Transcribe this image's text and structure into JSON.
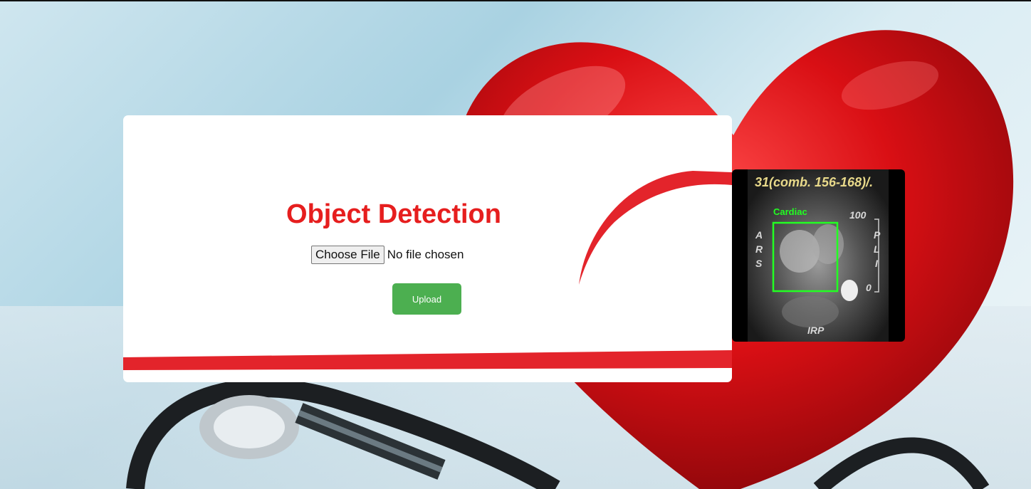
{
  "main": {
    "title": "Object Detection",
    "file_input": {
      "button_label": "Choose File",
      "status": "No file chosen"
    },
    "upload_label": "Upload"
  },
  "preview": {
    "header_text": "31(comb. 156-168)/.",
    "detection_label": "Cardiac",
    "scale_top": "100",
    "scale_bottom": "0",
    "left_letters": [
      "A",
      "R",
      "S"
    ],
    "right_letters": [
      "P",
      "L",
      "I"
    ],
    "bottom_text": "IRP"
  },
  "colors": {
    "title_red": "#e61e1e",
    "upload_green": "#4caf50",
    "detection_box": "#22ff22"
  }
}
